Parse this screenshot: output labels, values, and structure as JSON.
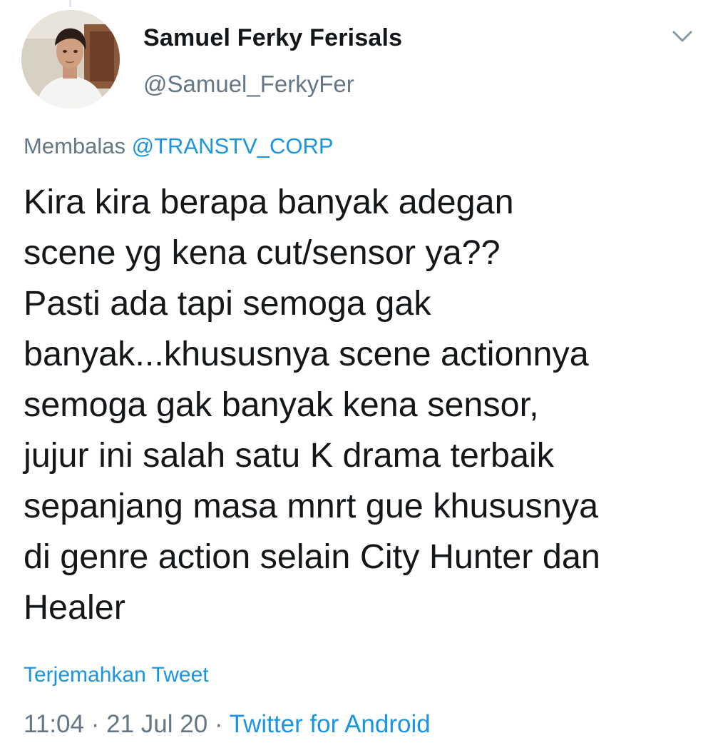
{
  "user": {
    "display_name": "Samuel Ferky Ferisals",
    "handle": "@Samuel_FerkyFer"
  },
  "reply": {
    "prefix": "Membalas ",
    "mention": "@TRANSTV_CORP"
  },
  "tweet": {
    "text": "Kira kira berapa banyak adegan\nscene yg kena cut/sensor ya??\nPasti ada tapi semoga gak\nbanyak...khususnya scene actionnya\nsemoga gak banyak kena sensor,\njujur ini salah satu K drama terbaik\nsepanjang masa mnrt gue khususnya\ndi genre action selain City Hunter dan\nHealer"
  },
  "translate_label": "Terjemahkan Tweet",
  "meta": {
    "time": "11:04",
    "separator": " · ",
    "date": "21 Jul 20",
    "source": "Twitter for Android"
  },
  "icons": {
    "menu": "chevron-down-icon",
    "avatar": "avatar"
  },
  "colors": {
    "link": "#1b95e0",
    "secondary": "#657786",
    "primary_text": "#14171a"
  }
}
